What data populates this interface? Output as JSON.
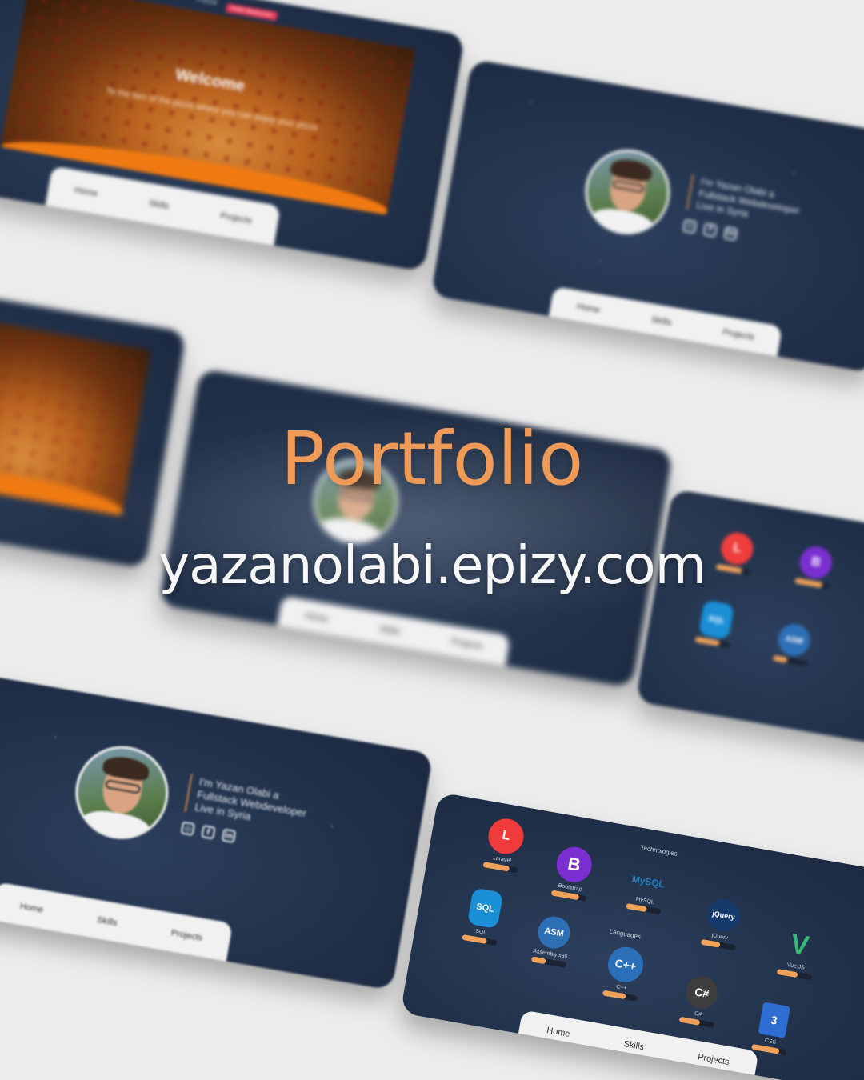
{
  "hero": {
    "title": "Portfolio",
    "url": "yazanolabi.epizy.com"
  },
  "colors": {
    "accent": "#f09a58",
    "card": "#22324b",
    "nav": "#f1f1f1",
    "skill_bar": "#f0a25a"
  },
  "nav": {
    "home": "Home",
    "skills": "Skills",
    "projects": "Projects"
  },
  "pizza": {
    "brand": "Pizza",
    "button": "Order Restaurant",
    "welcome": "Welcome",
    "subtitle": "To the fam of the pizza where you can enjoy your pizza"
  },
  "profile": {
    "line1": "I'm Yazan Olabi a",
    "line2": "Fullstack Webdeveloper",
    "line3": "Live in Syria",
    "socials": [
      "instagram-icon",
      "facebook-icon",
      "linkedin-icon"
    ]
  },
  "skills": {
    "technologies_label": "Technologies",
    "languages_label": "Languages",
    "items": [
      {
        "name": "Laravel",
        "icon": "laravel-icon",
        "color": "#ef3b3b",
        "level": 0.75
      },
      {
        "name": "Bootstrap",
        "icon": "bootstrap-icon",
        "color": "#7b2fd1",
        "level": 0.8
      },
      {
        "name": "MySQL",
        "icon": "mysql-icon",
        "color": "#1e3b5a",
        "level": 0.6
      },
      {
        "name": "jQuery",
        "icon": "jquery-icon",
        "color": "#163a6b",
        "level": 0.55
      },
      {
        "name": "Vue.JS",
        "icon": "vue-icon",
        "color": "#35b878",
        "level": 0.6
      },
      {
        "name": "SQL",
        "icon": "sql-icon",
        "color": "#1a8fd6",
        "level": 0.7
      },
      {
        "name": "Assembly x86",
        "icon": "asm-icon",
        "color": "#2d6fb5",
        "level": 0.4
      },
      {
        "name": "C++",
        "icon": "cpp-icon",
        "color": "#2a6fb8",
        "level": 0.65
      },
      {
        "name": "C#",
        "icon": "csharp-icon",
        "color": "#3d3d3d",
        "level": 0.6
      },
      {
        "name": "CSS",
        "icon": "css-icon",
        "color": "#2f6dd3",
        "level": 0.8
      }
    ],
    "asm_percent": "40%"
  }
}
